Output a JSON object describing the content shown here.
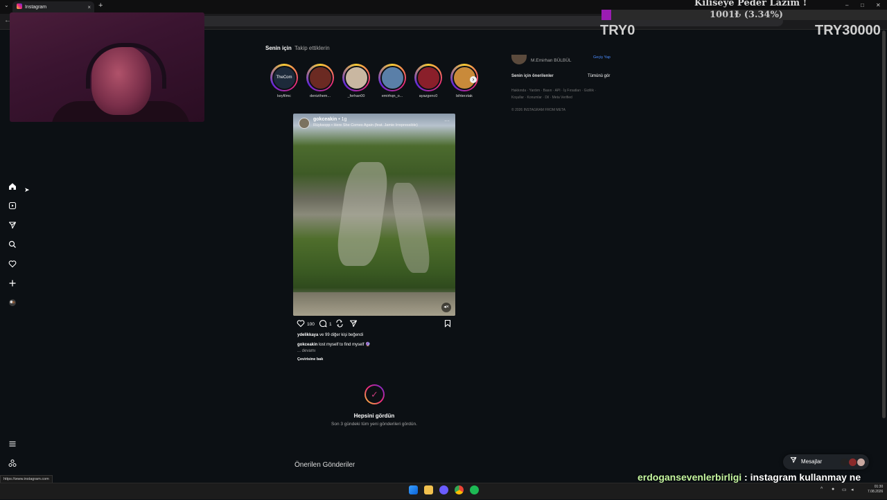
{
  "browser": {
    "tab_title": "Instagram",
    "tab_close": "×",
    "new_tab": "+",
    "tab_menu": "⌄",
    "back": "←",
    "window_min": "–",
    "window_max": "□",
    "window_close": "✕",
    "status_url": "https://www.instagram.com"
  },
  "donation": {
    "title": "Kiliseye Peder Lazım !",
    "amount": "1001₺ (3.34%)",
    "progress_percent": 3.34,
    "min_label": "TRY0",
    "max_label": "TRY30000",
    "fill_color": "#9b1cb3"
  },
  "feed": {
    "tab_for_you": "Senin için",
    "tab_following": "Takip ettiklerin"
  },
  "stories": [
    {
      "name": "keyfilmc",
      "avatar_text": "TheCom",
      "color": "#1d2a3a"
    },
    {
      "name": "denizthem...",
      "color": "#6b2a22"
    },
    {
      "name": "_ferhan00",
      "color": "#c9b7a1"
    },
    {
      "name": "emirhqn_o...",
      "color": "#5a7fa8"
    },
    {
      "name": "ayazgenc0",
      "color": "#8a1f2a"
    },
    {
      "name": "bihterztak",
      "color": "#c98a3a"
    }
  ],
  "post": {
    "username": "gokceakin",
    "time": "• 1g",
    "audio": "Rüyksopp • Here She Comes Again (feat. Jamie Irrepressible)",
    "more": "···",
    "mute": "🔇",
    "likes_count": "100",
    "comments_count": "1",
    "liked_by_user": "ydelikkaya",
    "liked_by_rest": " ve 99 diğer kişi beğendi",
    "liked_by_bold": "99 diğer kişi",
    "caption_user": "gokceakin",
    "caption_text": " lost myself to find myself 🔮",
    "more_text": "... devamı",
    "translate": "Çevirisine bak"
  },
  "caught_up": {
    "title": "Hepsini gördün",
    "subtitle": "Son 3 gündeki tüm yeni gönderileri gördün."
  },
  "suggested_posts": "Önerilen Gönderiler",
  "sidebar_right": {
    "user_name": "M.Emirhan BÜLBÜL",
    "switch": "Geçiş Yap",
    "suggestions": "Senin için önerilenler",
    "see_all": "Tümünü gör",
    "footer1": "Hakkında · Yardım · Basın · API · İş Fırsatları · Gizlilik ·",
    "footer2": "Koşullar · Konumlar · Dil · Meta Verified",
    "copyright": "© 2026 INSTAGRAM FROM META"
  },
  "messages": {
    "label": "Mesajlar"
  },
  "chat": {
    "user": "erdogansevenlerbirligi",
    "message": " : instagram kullanmay ne vakit bırakırsın"
  },
  "taskbar": {
    "time": "01:30",
    "date": "7.08.2026"
  },
  "icons": {
    "home": "home-icon",
    "reels": "reels-icon",
    "messages": "send-icon",
    "search": "search-icon",
    "notifications": "heart-icon",
    "create": "plus-icon",
    "profile": "avatar-icon",
    "menu": "menu-icon",
    "more": "apps-icon"
  }
}
